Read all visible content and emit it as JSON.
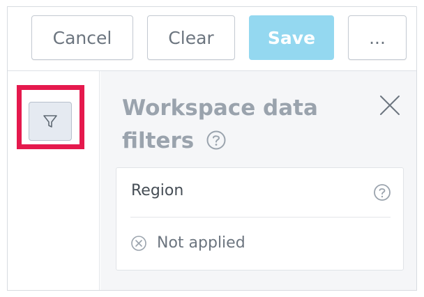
{
  "toolbar": {
    "cancel_label": "Cancel",
    "clear_label": "Clear",
    "save_label": "Save",
    "more_label": "..."
  },
  "rail": {
    "filter_button_icon": "funnel-icon",
    "highlight_color": "#e5194d"
  },
  "panel": {
    "title_line1": "Workspace data",
    "title_line2": "filters",
    "help_icon": "question-circle-icon",
    "close_icon": "close-icon",
    "filter": {
      "label": "Region",
      "status_icon": "x-circle-icon",
      "status_text": "Not applied"
    }
  },
  "colors": {
    "save_bg": "#94d8f0",
    "button_text": "#6c757f",
    "title_text": "#9aa3ad",
    "panel_bg": "#f5f6f8"
  }
}
